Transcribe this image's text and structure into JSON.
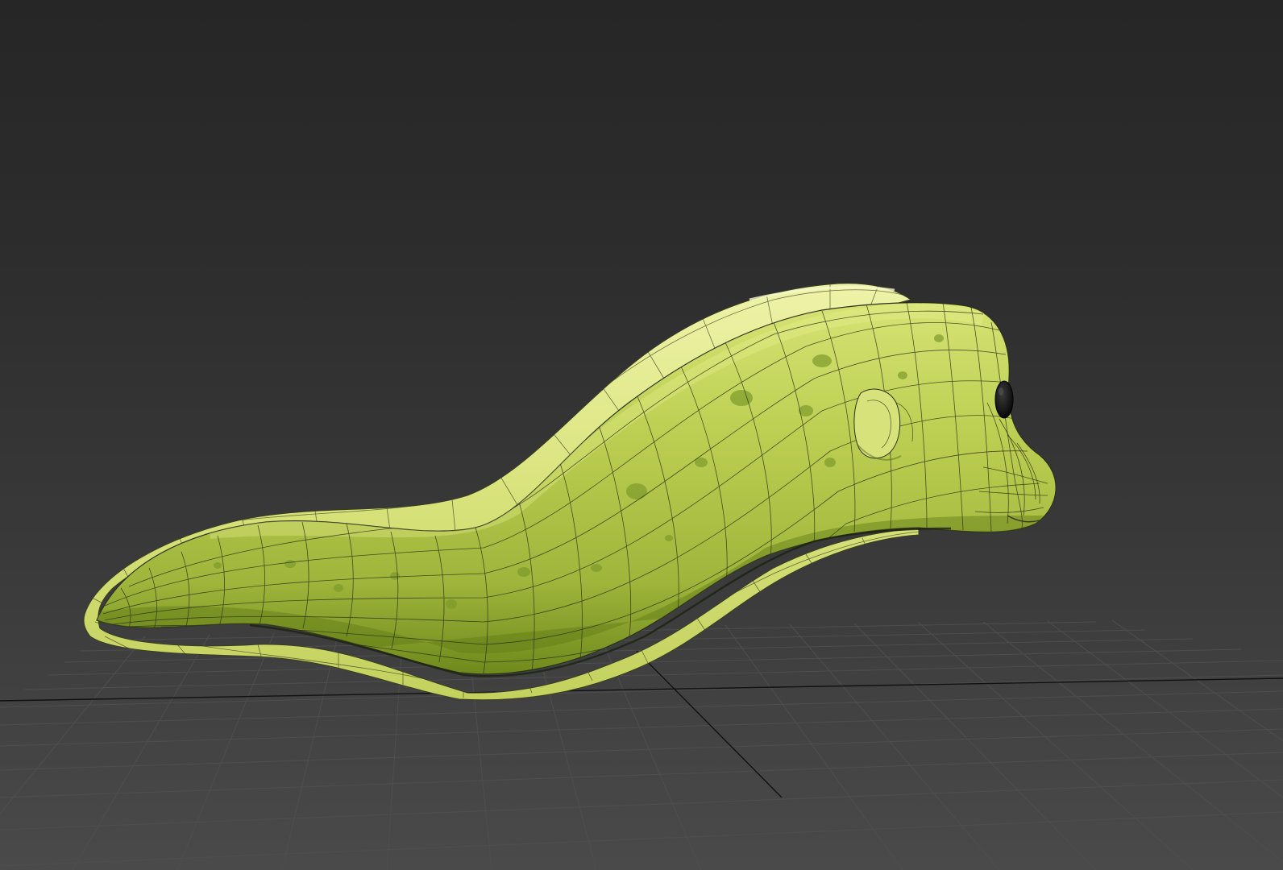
{
  "viewport": {
    "view": "perspective",
    "shading": "default-shading-with-edged-faces",
    "background_top": "#262626",
    "background_bottom": "#4a4a4a"
  },
  "grid": {
    "visible": true,
    "line_color": "#4e4e4e",
    "axis_color": "#111111"
  },
  "model": {
    "subject": "eel",
    "body_color": "#b6c94a",
    "fin_color": "#dfe88a",
    "highlight_color": "#e8f08e",
    "shadow_color": "#6f8a1c",
    "spot_color": "#7c9a2b",
    "wire_color": "#2b2f1a",
    "eye_color": "#0c0c0c"
  }
}
